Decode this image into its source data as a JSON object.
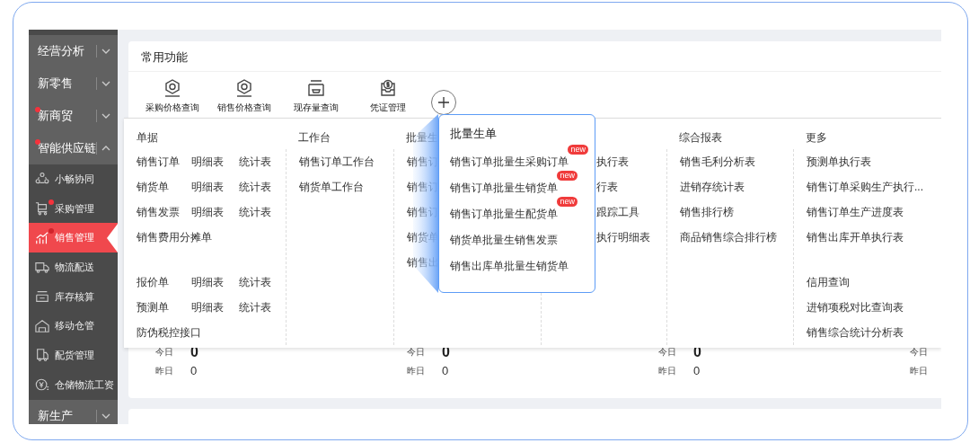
{
  "sidebar": {
    "items": [
      {
        "label": "经营分析",
        "expanded": false,
        "dot": false
      },
      {
        "label": "新零售",
        "expanded": false,
        "dot": false
      },
      {
        "label": "新商贸",
        "expanded": false,
        "dot": true
      },
      {
        "label": "智能供应链",
        "expanded": true,
        "dot": true,
        "children": [
          {
            "label": "小畅协同",
            "selected": false,
            "dot": false
          },
          {
            "label": "采购管理",
            "selected": false,
            "dot": true
          },
          {
            "label": "销售管理",
            "selected": true,
            "dot": true
          },
          {
            "label": "物流配送",
            "selected": false,
            "dot": false
          },
          {
            "label": "库存核算",
            "selected": false,
            "dot": false
          },
          {
            "label": "移动仓管",
            "selected": false,
            "dot": false
          },
          {
            "label": "配货管理",
            "selected": false,
            "dot": false
          },
          {
            "label": "仓储物流工资",
            "selected": false,
            "dot": false
          }
        ]
      },
      {
        "label": "新生产",
        "expanded": false,
        "dot": false
      }
    ]
  },
  "card": {
    "title": "常用功能",
    "shortcuts": [
      "采购价格查询",
      "销售价格查询",
      "现存量查询",
      "凭证管理"
    ],
    "stats": [
      {
        "today_label": "今日",
        "today": "0",
        "yesterday_label": "昨日",
        "yesterday": "0"
      },
      {
        "today_label": "今日",
        "today": "0",
        "yesterday_label": "昨日",
        "yesterday": "0"
      },
      {
        "today_label": "今日",
        "today": "0",
        "yesterday_label": "昨日",
        "yesterday": "0"
      },
      {
        "today_label": "今日",
        "yesterday_label": "昨日"
      }
    ]
  },
  "menu": {
    "columns": [
      {
        "title": "单据",
        "sections": [
          [
            [
              "销售订单",
              "明细表",
              "统计表"
            ],
            [
              "销货单",
              "明细表",
              "统计表"
            ],
            [
              "销售发票",
              "明细表",
              "统计表"
            ],
            [
              "销售费用分摊单"
            ]
          ],
          [
            [
              "报价单",
              "明细表",
              "统计表"
            ],
            [
              "预测单",
              "明细表",
              "统计表"
            ],
            [
              "防伪税控接口"
            ]
          ]
        ]
      },
      {
        "title": "工作台",
        "sections": [
          [
            [
              "销售订单工作台"
            ],
            [
              "销货单工作台"
            ]
          ]
        ]
      },
      {
        "title": "批量生",
        "sections": [
          [
            [
              "销售订"
            ],
            [
              "销售订"
            ],
            [
              "销售订"
            ],
            [
              "销货单"
            ],
            [
              "销售出"
            ]
          ]
        ]
      },
      {
        "sections": [
          [
            [
              "执行表"
            ],
            [
              "行表"
            ],
            [
              "跟踪工具"
            ],
            [
              "执行明细表"
            ]
          ]
        ]
      },
      {
        "title": "综合报表",
        "sections": [
          [
            [
              "销售毛利分析表"
            ],
            [
              "进销存统计表"
            ],
            [
              "销售排行榜"
            ],
            [
              "商品销售综合排行榜"
            ]
          ]
        ]
      },
      {
        "title": "更多",
        "sections": [
          [
            [
              "预测单执行表"
            ],
            [
              "销售订单采购生产执行..."
            ],
            [
              "销售订单生产进度表"
            ],
            [
              "销售出库开单执行表"
            ]
          ],
          [
            [
              "信用查询"
            ],
            [
              "进销项税对比查询表"
            ],
            [
              "销售综合统计分析表"
            ]
          ]
        ]
      }
    ]
  },
  "popup": {
    "title": "批量生单",
    "items": [
      {
        "label": "销售订单批量生采购订单",
        "badge": "new"
      },
      {
        "label": "销售订单批量生销货单",
        "badge": "new"
      },
      {
        "label": "销售订单批量生配货单",
        "badge": "new"
      },
      {
        "label": "销货单批量生销售发票"
      },
      {
        "label": "销售出库单批量生销货单"
      }
    ]
  }
}
